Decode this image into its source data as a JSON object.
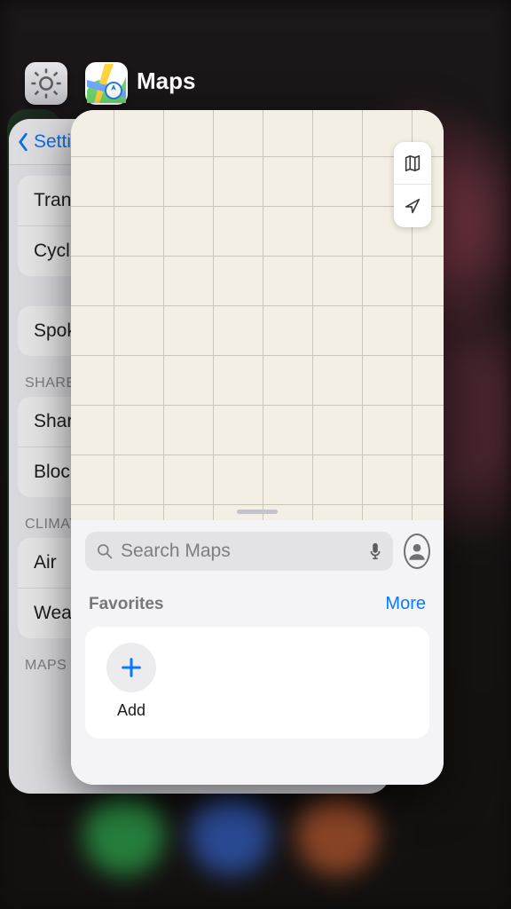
{
  "switcher": {
    "front_app_name": "Maps"
  },
  "settings_card": {
    "back_label": "Settings",
    "rows": [
      "Transit",
      "Cycling"
    ],
    "rows2": [
      "Spoken"
    ],
    "section_share": "SHARE",
    "rows3": [
      "Share",
      "Block"
    ],
    "section_climate": "CLIMATE",
    "rows4": [
      "Air",
      "Weather"
    ],
    "section_maps": "MAPS"
  },
  "maps_card": {
    "search_placeholder": "Search Maps",
    "favorites_title": "Favorites",
    "more_label": "More",
    "add_label": "Add"
  }
}
